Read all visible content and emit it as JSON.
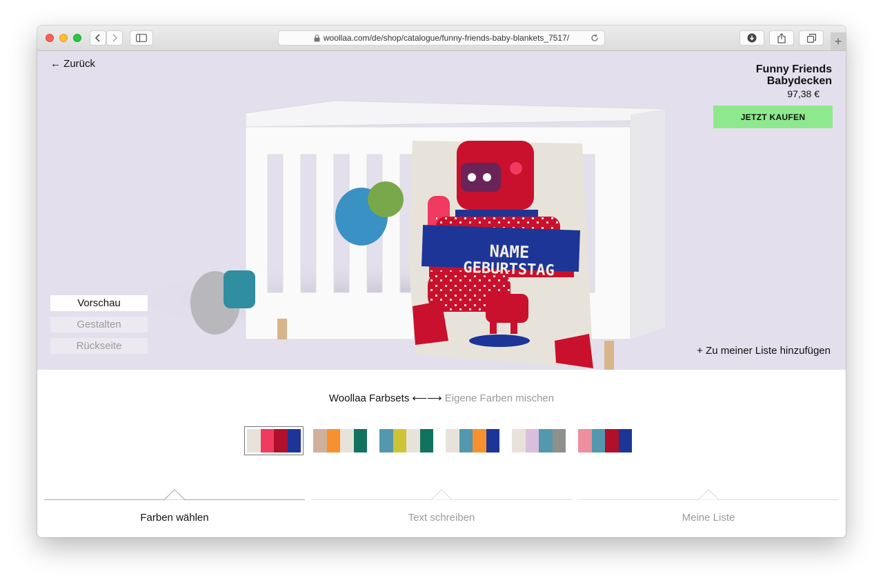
{
  "browser": {
    "url": "woollaa.com/de/shop/catalogue/funny-friends-baby-blankets_7517/"
  },
  "hero": {
    "back_label": "← Zurück",
    "product_title_line1": "Funny Friends",
    "product_title_line2": "Babydecken",
    "price": "97,38 €",
    "buy_button": "JETZT KAUFEN",
    "add_to_list": "+ Zu meiner Liste hinzufügen",
    "banner_line1": "NAME",
    "banner_line2": "GEBURTSTAG",
    "view_buttons": [
      "Vorschau",
      "Gestalten",
      "Rückseite"
    ]
  },
  "palettes": {
    "tab_active": "Woollaa Farbsets",
    "arrows": "⟵⟶",
    "tab_inactive": "Eigene Farben mischen",
    "sets": [
      {
        "selected": true,
        "colors": [
          "#e8e3da",
          "#f03a60",
          "#b0102a",
          "#1d3597"
        ]
      },
      {
        "selected": false,
        "colors": [
          "#d0b09a",
          "#f7902e",
          "#e8e3da",
          "#11735e"
        ]
      },
      {
        "selected": false,
        "colors": [
          "#5398ae",
          "#cfc436",
          "#e8e3da",
          "#11735e"
        ]
      },
      {
        "selected": false,
        "colors": [
          "#e8e3da",
          "#5398ae",
          "#f7902e",
          "#1d3597"
        ]
      },
      {
        "selected": false,
        "colors": [
          "#e8e3da",
          "#dbbedc",
          "#5398ae",
          "#8c928a"
        ]
      },
      {
        "selected": false,
        "colors": [
          "#ef8f9c",
          "#5398ae",
          "#b0102a",
          "#1d3597"
        ]
      }
    ]
  },
  "steps": [
    {
      "label": "Farben wählen",
      "active": true
    },
    {
      "label": "Text schreiben",
      "active": false
    },
    {
      "label": "Meine Liste",
      "active": false
    }
  ],
  "colors": {
    "hero_bg": "#e3dfec",
    "buy_button_bg": "#8ee98e",
    "step_line_active": "#a9a9a9",
    "step_line_inactive": "#dddddd",
    "muted_text": "#9a9a9a"
  }
}
